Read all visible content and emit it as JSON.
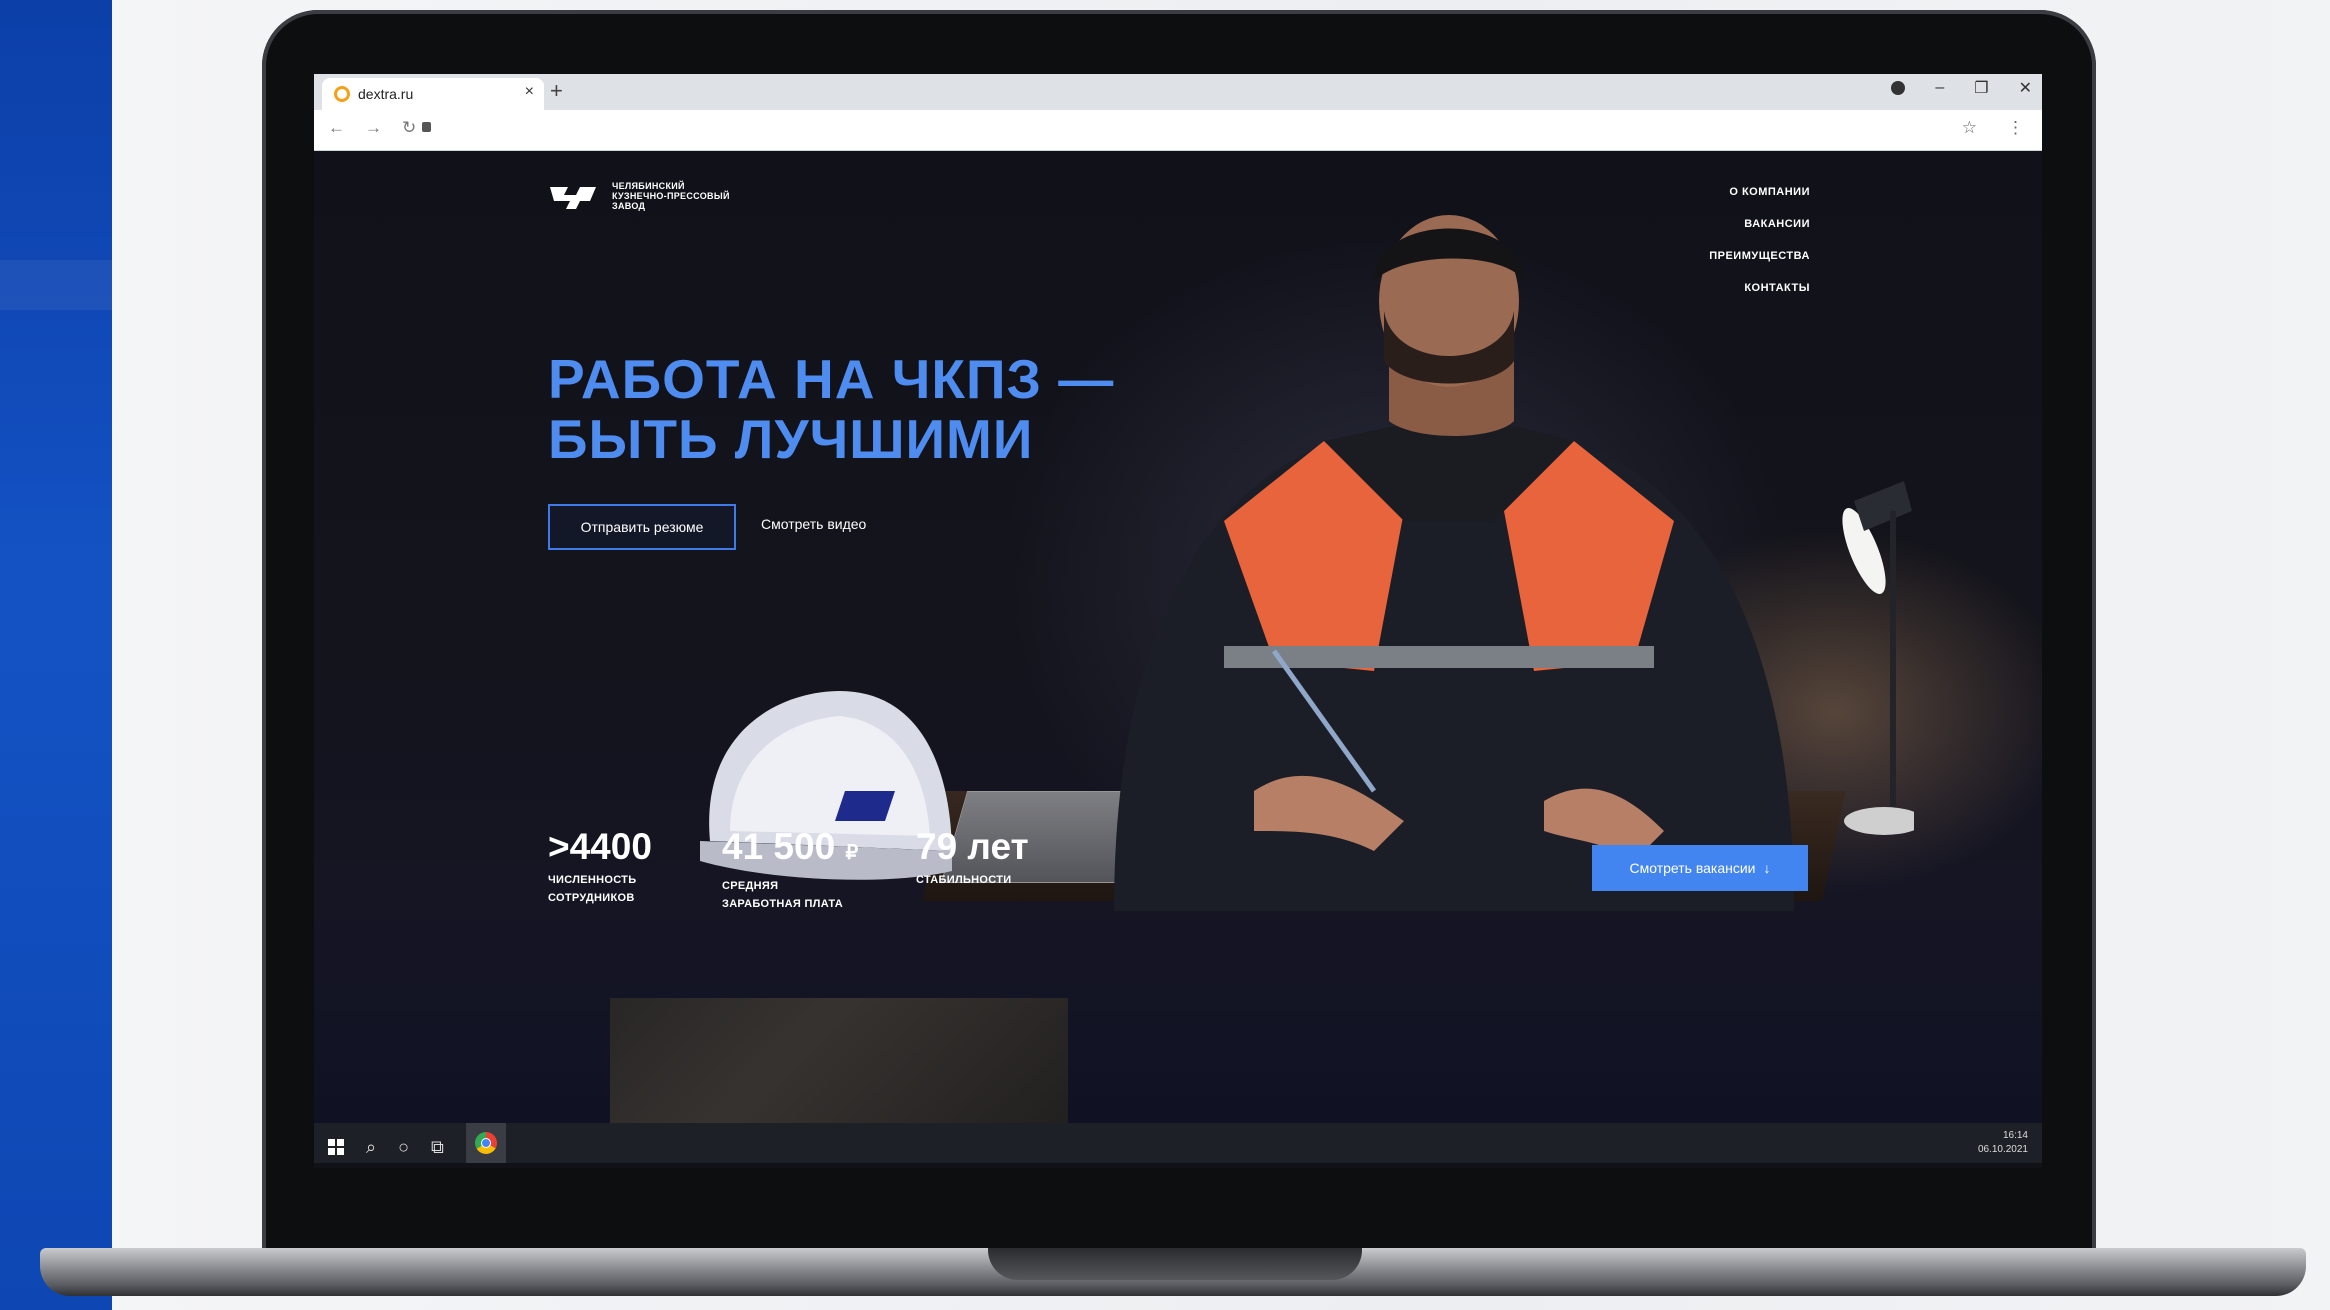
{
  "browser": {
    "tab_title": "dextra.ru",
    "tab_close": "×",
    "new_tab": "+",
    "window_buttons": [
      "–",
      "❐",
      "✕"
    ],
    "nav_icons": [
      "←",
      "→",
      "↻"
    ],
    "address_right_icons": [
      "☆",
      "⋮"
    ]
  },
  "site": {
    "logo_lines": [
      "ЧЕЛЯБИНСКИЙ",
      "КУЗНЕЧНО-ПРЕССОВЫЙ",
      "ЗАВОД"
    ],
    "nav": [
      "О КОМПАНИИ",
      "ВАКАНСИИ",
      "ПРЕИМУЩЕСТВА",
      "КОНТАКТЫ"
    ],
    "headline_line1": "РАБОТА НА ЧКПЗ —",
    "headline_line2": "БЫТЬ ЛУЧШИМИ",
    "btn_resume": "Отправить резюме",
    "btn_video": "Смотреть видео",
    "stats": [
      {
        "value": ">4400",
        "suffix": "",
        "label1": "ЧИСЛЕННОСТЬ",
        "label2": "СОТРУДНИКОВ"
      },
      {
        "value": "41 500",
        "suffix": "₽",
        "label1": "СРЕДНЯЯ",
        "label2": "ЗАРАБОТНАЯ ПЛАТА"
      },
      {
        "value": "79 лет",
        "suffix": "",
        "label1": "СТАБИЛЬНОСТИ",
        "label2": ""
      }
    ],
    "btn_vacancies": "Смотреть вакансии",
    "btn_vacancies_arrow": "↓"
  },
  "taskbar": {
    "search_icon": "⌕",
    "cortana_icon": "○",
    "taskview_icon": "⧉",
    "time": "16:14",
    "date": "06.10.2021"
  },
  "colors": {
    "accent": "#4385f0",
    "headline": "#4f8cf0",
    "vest": "#e8643c"
  }
}
